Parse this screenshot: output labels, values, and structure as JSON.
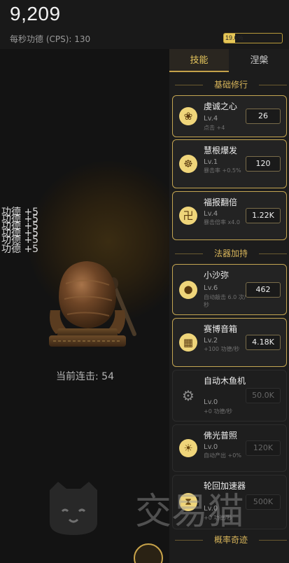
{
  "header": {
    "score": "9,209",
    "cps_text": "每秒功德 (CPS): 130",
    "progress_text": "19.6%",
    "progress_fraction": 0.196
  },
  "play": {
    "float_texts": [
      "功德 +5",
      "功德 +5",
      "功德 +5",
      "功德 +5",
      "功德 +5",
      "功德 +5"
    ],
    "combo_text": "当前连击: 54"
  },
  "tabs": [
    {
      "label": "技能",
      "active": true
    },
    {
      "label": "涅槃",
      "active": false
    }
  ],
  "sections": {
    "basic": "基础修行",
    "artifact": "法器加持",
    "chance": "概率奇迹"
  },
  "skills": [
    {
      "name": "虔诚之心",
      "level": "Lv.4",
      "desc": "点击 +4",
      "cost": "26",
      "icon": "lotus-icon"
    },
    {
      "name": "慧根爆发",
      "level": "Lv.1",
      "desc": "暴击率 +0.5%",
      "cost": "120",
      "icon": "dharma-wheel-icon"
    },
    {
      "name": "福报翻倍",
      "level": "Lv.4",
      "desc": "暴击倍率 x4.0",
      "cost": "1.22K",
      "icon": "swastika-icon"
    }
  ],
  "artifacts": [
    {
      "name": "小沙弥",
      "level": "Lv.6",
      "desc": "自动敲击 6.0 次/秒",
      "cost": "462",
      "icon": "monk-icon",
      "enabled": true
    },
    {
      "name": "赛博音箱",
      "level": "Lv.2",
      "desc": "+100 功德/秒",
      "cost": "4.18K",
      "icon": "speaker-icon",
      "enabled": true
    },
    {
      "name": "自动木鱼机",
      "level": "Lv.0",
      "desc": "+0 功德/秒",
      "cost": "50.0K",
      "icon": "gear-icon",
      "enabled": false
    },
    {
      "name": "佛光普照",
      "level": "Lv.0",
      "desc": "自动产出 +0%",
      "cost": "120K",
      "icon": "sun-icon",
      "enabled": true
    },
    {
      "name": "轮回加速器",
      "level": "Lv.0",
      "desc": "+0 功德/秒",
      "cost": "500K",
      "icon": "hourglass-icon",
      "enabled": true
    }
  ],
  "watermark": "交易猫"
}
